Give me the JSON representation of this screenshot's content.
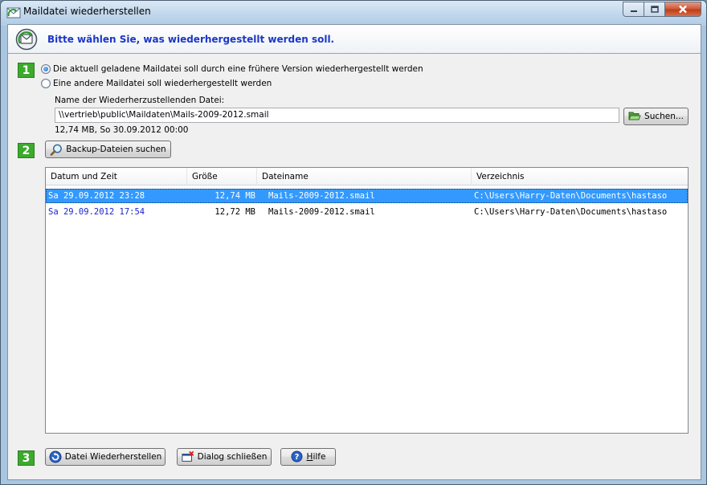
{
  "window": {
    "title": "Maildatei wiederherstellen"
  },
  "header": {
    "text": "Bitte wählen Sie, was wiederhergestellt werden soll."
  },
  "steps": [
    "1",
    "2",
    "3"
  ],
  "options": {
    "current": "Die aktuell geladene Maildatei soll durch eine frühere Version wiederhergestellt werden",
    "other": "Eine andere Maildatei soll  wiederhergestellt werden",
    "selected": "current"
  },
  "file": {
    "label": "Name der Wiederherzustellenden Datei:",
    "value": "\\\\vertrieb\\public\\Maildaten\\Mails-2009-2012.smail",
    "info": "12,74 MB, So 30.09.2012 00:00"
  },
  "buttons": {
    "search": "Suchen...",
    "backup_search": "Backup-Dateien suchen",
    "restore": "Datei Wiederherstellen",
    "close": "Dialog schließen",
    "help_prefix": "",
    "help_mnemonic": "H",
    "help_rest": "ilfe"
  },
  "table": {
    "columns": [
      "Datum und Zeit",
      "Größe",
      "Dateiname",
      "Verzeichnis"
    ],
    "rows": [
      {
        "date": "Sa 29.09.2012 23:28",
        "size": "12,74 MB",
        "name": "Mails-2009-2012.smail",
        "dir": "C:\\Users\\Harry-Daten\\Documents\\hastaso",
        "selected": true
      },
      {
        "date": "Sa 29.09.2012 17:54",
        "size": "12,72 MB",
        "name": "Mails-2009-2012.smail",
        "dir": "C:\\Users\\Harry-Daten\\Documents\\hastaso",
        "selected": false
      }
    ]
  },
  "colors": {
    "accent": "#1b36c8",
    "step": "#3caa2c",
    "selection": "#3399ff"
  }
}
